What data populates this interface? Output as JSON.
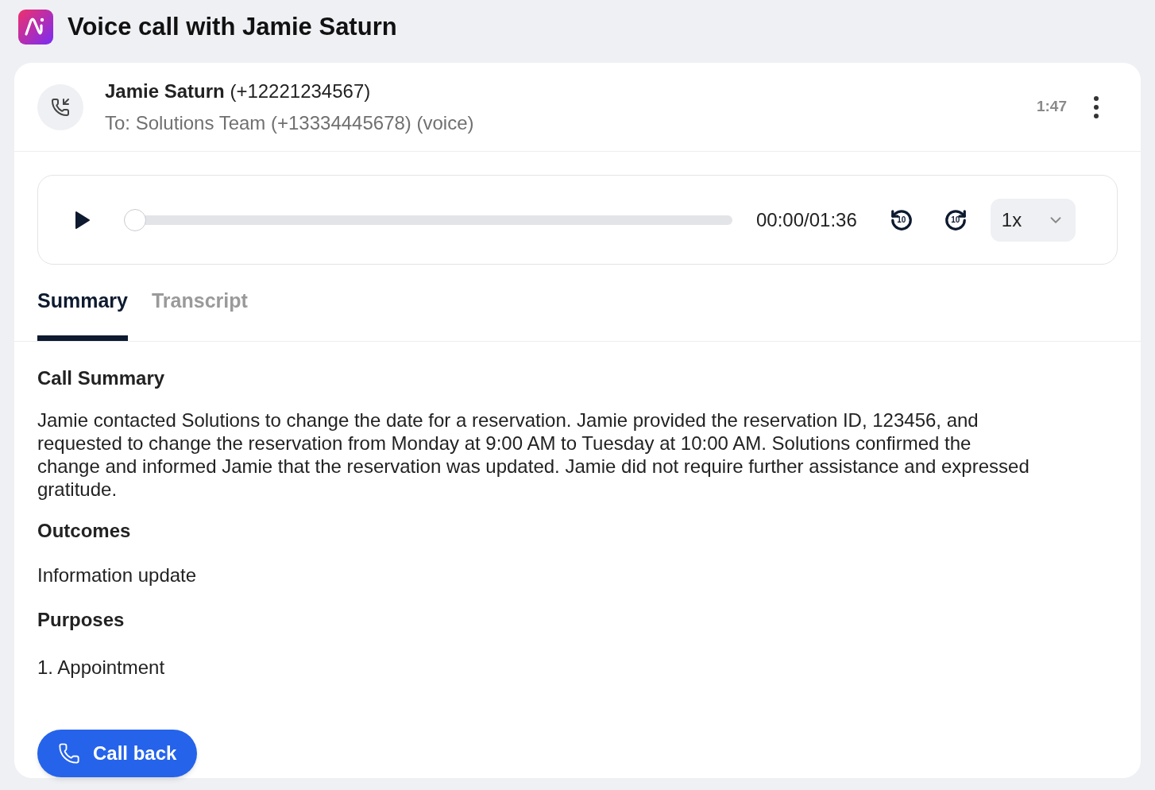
{
  "page": {
    "title": "Voice call with Jamie Saturn"
  },
  "call": {
    "caller_name": "Jamie Saturn",
    "caller_number": "(+12221234567)",
    "to": "To: Solutions Team (+13334445678) (voice)",
    "duration": "1:47"
  },
  "player": {
    "level": 0,
    "time": "00:00/01:36",
    "rewind_label": "10",
    "forward_label": "10",
    "speed": "1x"
  },
  "tabs": [
    {
      "label": "Summary",
      "selected": true
    },
    {
      "label": "Transcript",
      "selected": false
    }
  ],
  "summary": {
    "heading": "Call Summary",
    "text": "Jamie contacted Solutions to change the date for a reservation. Jamie provided the reservation ID, 123456, and requested to change the reservation from Monday at 9:00 AM to Tuesday at 10:00 AM. Solutions confirmed the change and informed Jamie that the reservation was updated. Jamie did not require further assistance and expressed gratitude.",
    "outcomes_heading": "Outcomes",
    "outcomes": [
      "Information update"
    ],
    "purposes_heading": "Purposes",
    "purposes": [
      "1. Appointment"
    ]
  },
  "call_back_button": "Call back"
}
